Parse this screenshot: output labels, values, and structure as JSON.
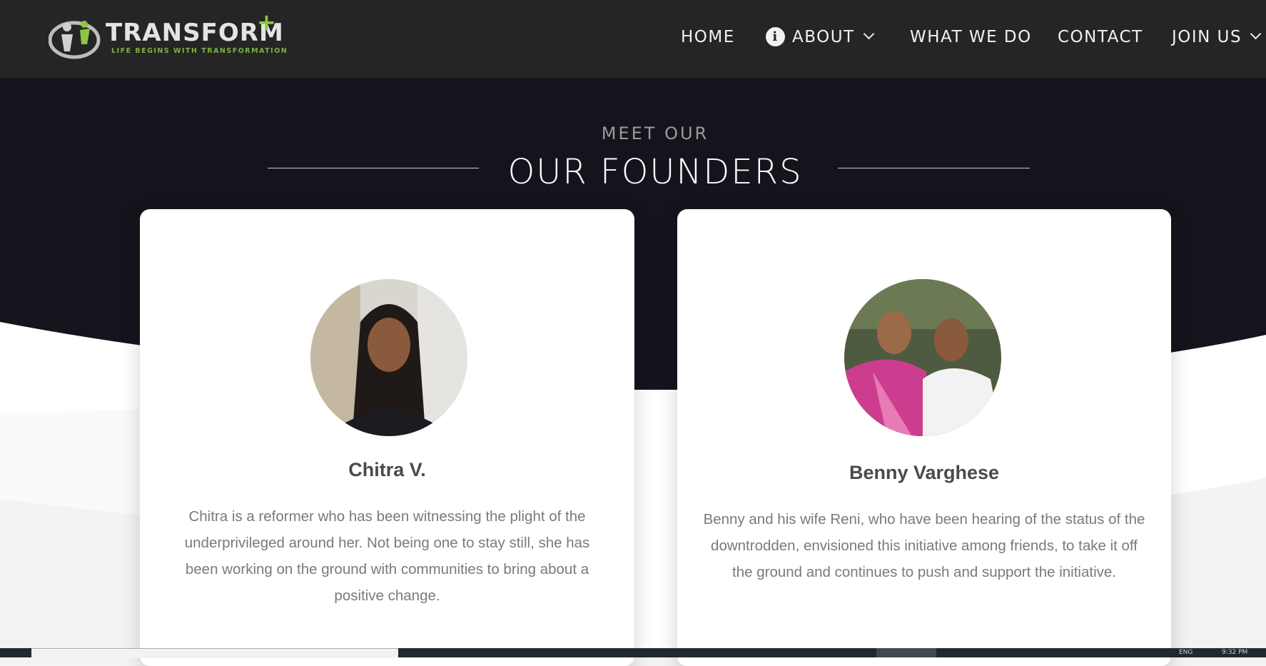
{
  "brand": {
    "name": "TRANSFORM",
    "plus": "+",
    "tagline": "LIFE BEGINS WITH TRANSFORMATION"
  },
  "nav": {
    "home": "HOME",
    "about": "ABOUT",
    "what_we_do": "WHAT WE DO",
    "contact": "CONTACT",
    "join_us": "JOIN US",
    "info_glyph": "i"
  },
  "section": {
    "eyebrow": "MEET OUR",
    "title": "OUR FOUNDERS"
  },
  "founders": [
    {
      "name": "Chitra V.",
      "bio": "Chitra is a reformer who has been witnessing the plight of the underprivileged around her. Not being one to stay still, she has been working on the ground with communities to bring about a positive change."
    },
    {
      "name": "Benny Varghese",
      "bio": "Benny and his wife Reni, who have been hearing of the status of the downtrodden, envisioned this initiative among friends, to take it off the ground and continues to push and support the initiative."
    }
  ],
  "taskbar": {
    "lang": "ENG",
    "time": "9:32 PM"
  },
  "colors": {
    "navbar": "#252526",
    "hero_dark": "#14151c",
    "accent_green": "#8dc63f",
    "card_bg": "#ffffff",
    "name_text": "#4a4a4a",
    "bio_text": "#7a7a7a"
  }
}
